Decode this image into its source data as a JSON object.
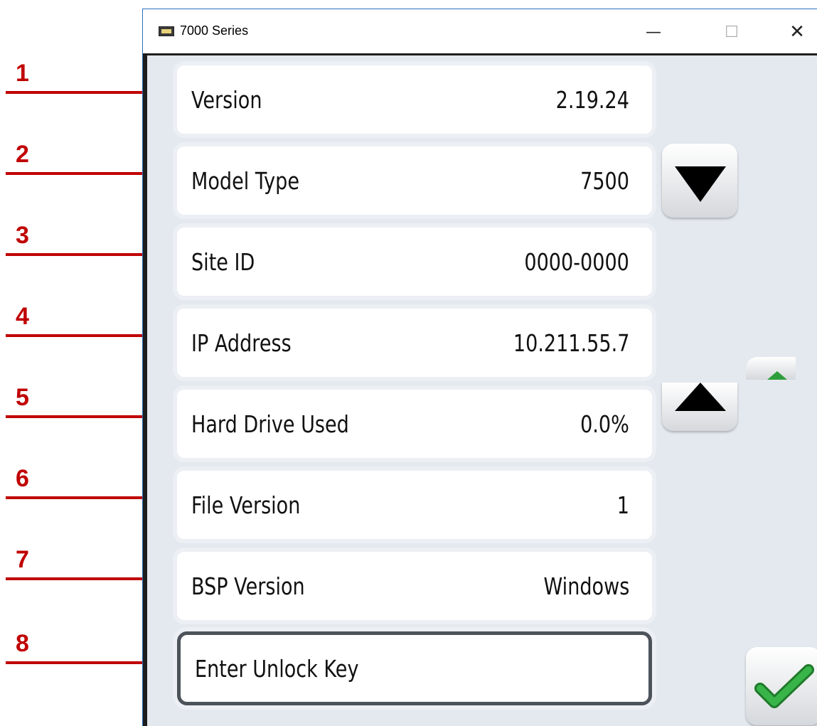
{
  "window": {
    "title": "7000 Series",
    "controls": {
      "minimize": "—",
      "maximize": "☐",
      "close": "✕"
    }
  },
  "callouts": [
    "1",
    "2",
    "3",
    "4",
    "5",
    "6",
    "7",
    "8"
  ],
  "rows": [
    {
      "label": "Version",
      "value": "2.19.24"
    },
    {
      "label": "Model  Type",
      "value": "7500"
    },
    {
      "label": "Site  ID",
      "value": "0000-0000"
    },
    {
      "label": "IP  Address",
      "value": "10.211.55.7"
    },
    {
      "label": "Hard  Drive  Used",
      "value": "0.0%"
    },
    {
      "label": "File Version",
      "value": "1"
    },
    {
      "label": "BSP Version",
      "value": "Windows"
    }
  ],
  "unlock": {
    "label": "Enter  Unlock  Key"
  },
  "colors": {
    "callout": "#c00000",
    "check": "#2e9e3a",
    "client_bg": "#e4e9ef"
  }
}
